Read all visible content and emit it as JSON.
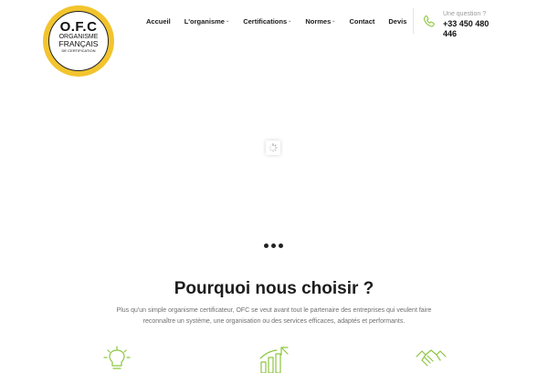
{
  "logo": {
    "title": "O.F.C",
    "line1": "ORGANISME",
    "line2": "FRANÇAIS",
    "line3": "DE CERTIFICATION",
    "ring_color": "#f2c42e"
  },
  "nav": {
    "items": [
      {
        "label": "Accueil",
        "dropdown": false
      },
      {
        "label": "L'organisme",
        "dropdown": true
      },
      {
        "label": "Certifications",
        "dropdown": true
      },
      {
        "label": "Normes",
        "dropdown": true
      },
      {
        "label": "Contact",
        "dropdown": false
      },
      {
        "label": "Devis",
        "dropdown": false
      }
    ],
    "caret": "⌄"
  },
  "contact": {
    "question": "Une question ?",
    "phone": "+33 450 480 446",
    "icon": "phone-icon",
    "accent": "#8dc63f"
  },
  "slider": {
    "loader_icon": "spinner-icon",
    "dot_count": 3
  },
  "why": {
    "title": "Pourquoi nous choisir ?",
    "text": "Plus qu'un simple organisme certificateur, OFC se veut avant tout le partenaire des entreprises qui veulent faire reconnaître un système, une organisation ou des services efficaces, adaptés et performants.",
    "icons": [
      "lightbulb-icon",
      "growth-chart-icon",
      "handshake-icon"
    ],
    "icon_color": "#8dc63f"
  }
}
